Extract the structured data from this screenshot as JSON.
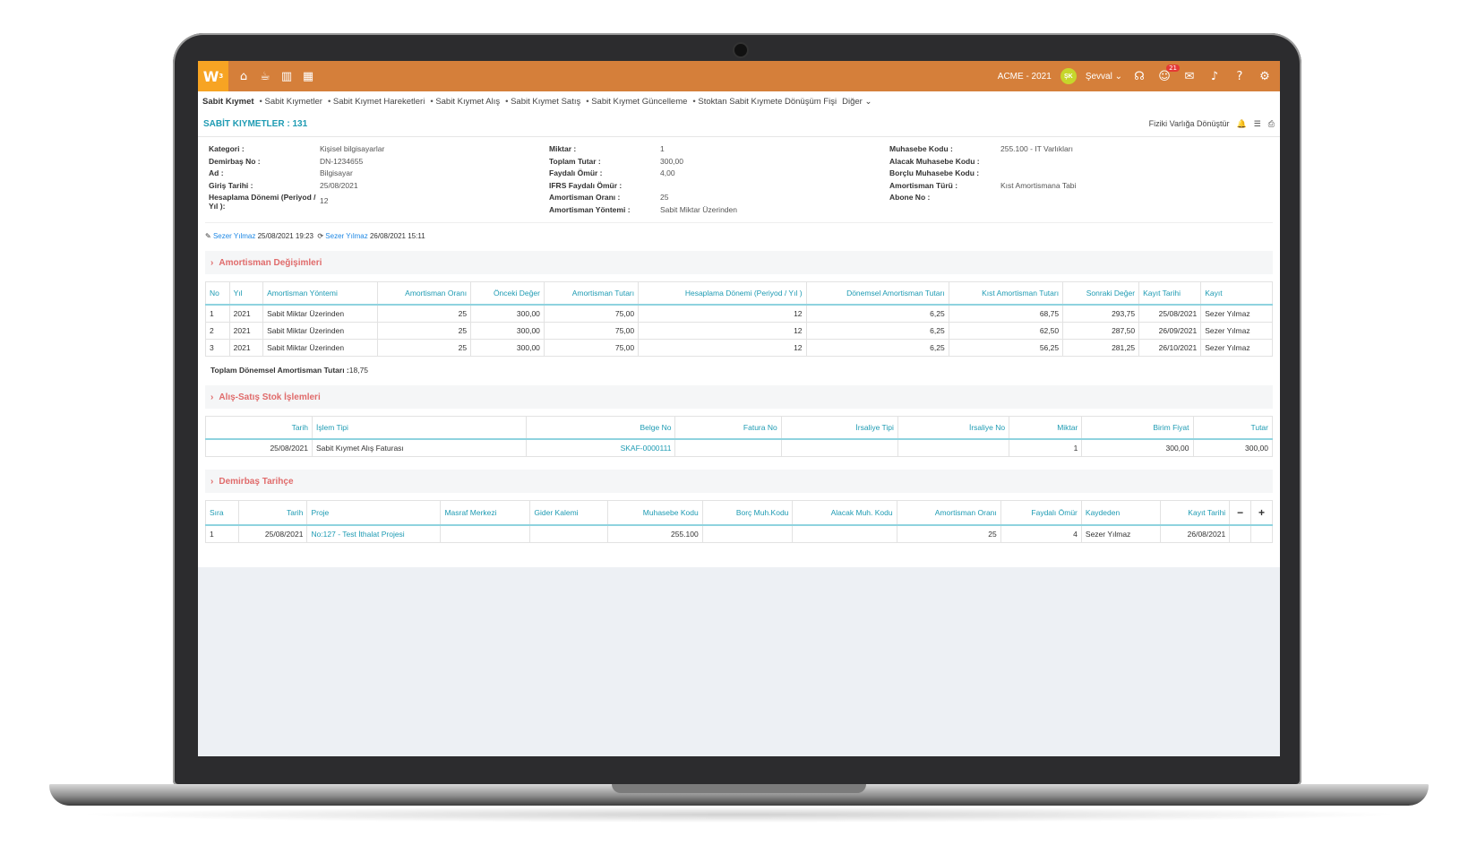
{
  "brand": {
    "logo": "W"
  },
  "topbar": {
    "company": "ACME - 2021",
    "user_initials": "ŞK",
    "user_name": "Şevval",
    "notification_count": "21",
    "accent_color": "#d57f3a"
  },
  "subnav": {
    "items": [
      "Sabit Kıymet",
      "Sabit Kıymetler",
      "Sabit Kıymet Hareketleri",
      "Sabit Kıymet Alış",
      "Sabit Kıymet Satış",
      "Sabit Kıymet Güncelleme",
      "Stoktan Sabit Kıymete Dönüşüm Fişi"
    ],
    "more": "Diğer"
  },
  "page": {
    "title": "SABİT KIYMETLER : 131",
    "action": "Fiziki Varlığa Dönüştür"
  },
  "info": {
    "col1": [
      {
        "label": "Kategori :",
        "value": "Kişisel bilgisayarlar"
      },
      {
        "label": "Demirbaş No :",
        "value": "DN-1234655"
      },
      {
        "label": "Ad :",
        "value": "Bilgisayar"
      },
      {
        "label": "Giriş Tarihi :",
        "value": "25/08/2021"
      },
      {
        "label": "Hesaplama Dönemi (Periyod / Yıl ):",
        "value": "12"
      }
    ],
    "col2": [
      {
        "label": "Miktar :",
        "value": "1"
      },
      {
        "label": "Toplam Tutar :",
        "value": "300,00"
      },
      {
        "label": "Faydalı Ömür :",
        "value": "4,00"
      },
      {
        "label": "IFRS Faydalı Ömür :",
        "value": ""
      },
      {
        "label": "Amortisman Oranı :",
        "value": "25"
      },
      {
        "label": "Amortisman Yöntemi :",
        "value": "Sabit Miktar Üzerinden"
      }
    ],
    "col3": [
      {
        "label": "Muhasebe Kodu :",
        "value": "255.100 - IT Varlıkları"
      },
      {
        "label": "Alacak Muhasebe Kodu :",
        "value": ""
      },
      {
        "label": "Borçlu Muhasebe Kodu :",
        "value": ""
      },
      {
        "label": "Amortisman Türü :",
        "value": "Kıst Amortismana Tabi"
      },
      {
        "label": "Abone No :",
        "value": ""
      }
    ]
  },
  "audit": {
    "created_by": "Sezer Yılmaz",
    "created_at": "25/08/2021 19:23",
    "updated_by": "Sezer Yılmaz",
    "updated_at": "26/08/2021 15:11"
  },
  "amortisman": {
    "title": "Amortisman Değişimleri",
    "headers": [
      "No",
      "Yıl",
      "Amortisman Yöntemi",
      "Amortisman Oranı",
      "Önceki Değer",
      "Amortisman Tutarı",
      "Hesaplama Dönemi (Periyod / Yıl )",
      "Dönemsel Amortisman Tutarı",
      "Kıst Amortisman Tutarı",
      "Sonraki Değer",
      "Kayıt Tarihi",
      "Kayıt"
    ],
    "rows": [
      [
        "1",
        "2021",
        "Sabit Miktar Üzerinden",
        "25",
        "300,00",
        "75,00",
        "12",
        "6,25",
        "68,75",
        "293,75",
        "25/08/2021",
        "Sezer Yılmaz"
      ],
      [
        "2",
        "2021",
        "Sabit Miktar Üzerinden",
        "25",
        "300,00",
        "75,00",
        "12",
        "6,25",
        "62,50",
        "287,50",
        "26/09/2021",
        "Sezer Yılmaz"
      ],
      [
        "3",
        "2021",
        "Sabit Miktar Üzerinden",
        "25",
        "300,00",
        "75,00",
        "12",
        "6,25",
        "56,25",
        "281,25",
        "26/10/2021",
        "Sezer Yılmaz"
      ]
    ],
    "total_label": "Toplam Dönemsel Amortisman Tutarı :",
    "total_value": "18,75"
  },
  "stok": {
    "title": "Alış-Satış Stok İşlemleri",
    "headers": [
      "Tarih",
      "İşlem Tipi",
      "Belge No",
      "Fatura No",
      "İrsaliye Tipi",
      "İrsaliye No",
      "Miktar",
      "Birim Fiyat",
      "Tutar"
    ],
    "rows": [
      [
        "25/08/2021",
        "Sabit Kıymet Alış Faturası",
        "SKAF-0000111",
        "",
        "",
        "",
        "1",
        "300,00",
        "300,00"
      ]
    ]
  },
  "tarihce": {
    "title": "Demirbaş Tarihçe",
    "headers": [
      "Sıra",
      "Tarih",
      "Proje",
      "Masraf Merkezi",
      "Gider Kalemi",
      "Muhasebe Kodu",
      "Borç Muh.Kodu",
      "Alacak Muh. Kodu",
      "Amortisman Oranı",
      "Faydalı Ömür",
      "Kaydeden",
      "Kayıt Tarihi"
    ],
    "rows": [
      [
        "1",
        "25/08/2021",
        "No:127 - Test İthalat Projesi",
        "",
        "",
        "255.100",
        "",
        "",
        "25",
        "4",
        "Sezer Yılmaz",
        "26/08/2021"
      ]
    ]
  }
}
